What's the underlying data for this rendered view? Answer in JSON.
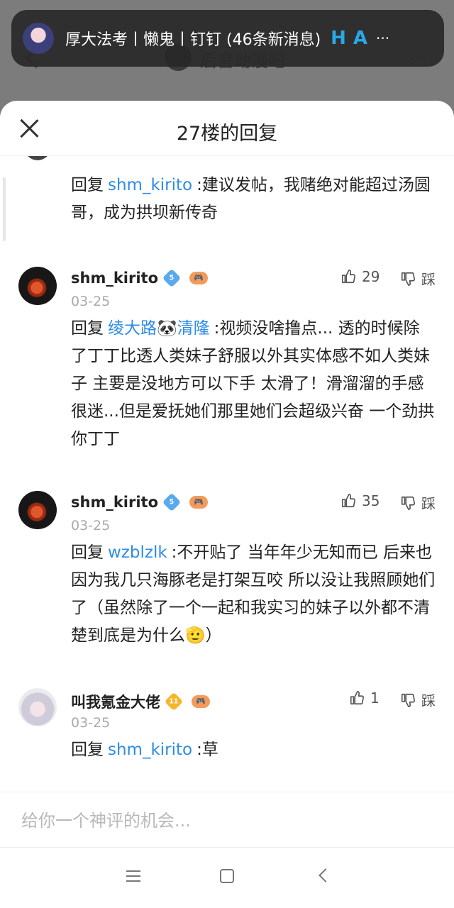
{
  "background": {
    "forum_title": "后宫动漫吧",
    "more_label": "···"
  },
  "notification": {
    "text": "厚大法考丨懒鬼丨钉钉 (46条新消息)",
    "icon_h": "H",
    "icon_a": "A",
    "more": "···"
  },
  "sheet": {
    "title": "27楼的回复",
    "partial_reply": {
      "prefix": "回复",
      "mention": "shm_kirito",
      "text": ":建议发帖，我赌绝对能超过汤圆哥，成为拱坝新传奇"
    },
    "replies": [
      {
        "username": "shm_kirito",
        "level": "5",
        "date": "03-25",
        "likes": "29",
        "dislike_label": "踩",
        "prefix": "回复",
        "mention": "绫大路🐼清隆",
        "text": ":视频没啥撸点... 透的时候除了丁丁比透人类妹子舒服以外其实体感不如人类妹子 主要是没地方可以下手 太滑了！滑溜溜的手感很迷...但是爱抚她们那里她们会超级兴奋 一个劲拱你丁丁"
      },
      {
        "username": "shm_kirito",
        "level": "5",
        "date": "03-25",
        "likes": "35",
        "dislike_label": "踩",
        "prefix": "回复",
        "mention": "wzblzlk",
        "text": ":不开贴了 当年年少无知而已 后来也因为我几只海豚老是打架互咬 所以没让我照顾她们了（虽然除了一个一起和我实习的妹子以外都不清楚到底是为什么🫡）"
      },
      {
        "username": "叫我氪金大佬",
        "level": "11",
        "date": "03-25",
        "likes": "1",
        "dislike_label": "踩",
        "prefix": "回复",
        "mention": "shm_kirito",
        "text": ":草"
      }
    ],
    "input_placeholder": "给你一个神评的机会..."
  },
  "colors": {
    "mention": "#2d8ce6",
    "level_blue": "#5aa9ee",
    "level_gold": "#f6b62b"
  }
}
